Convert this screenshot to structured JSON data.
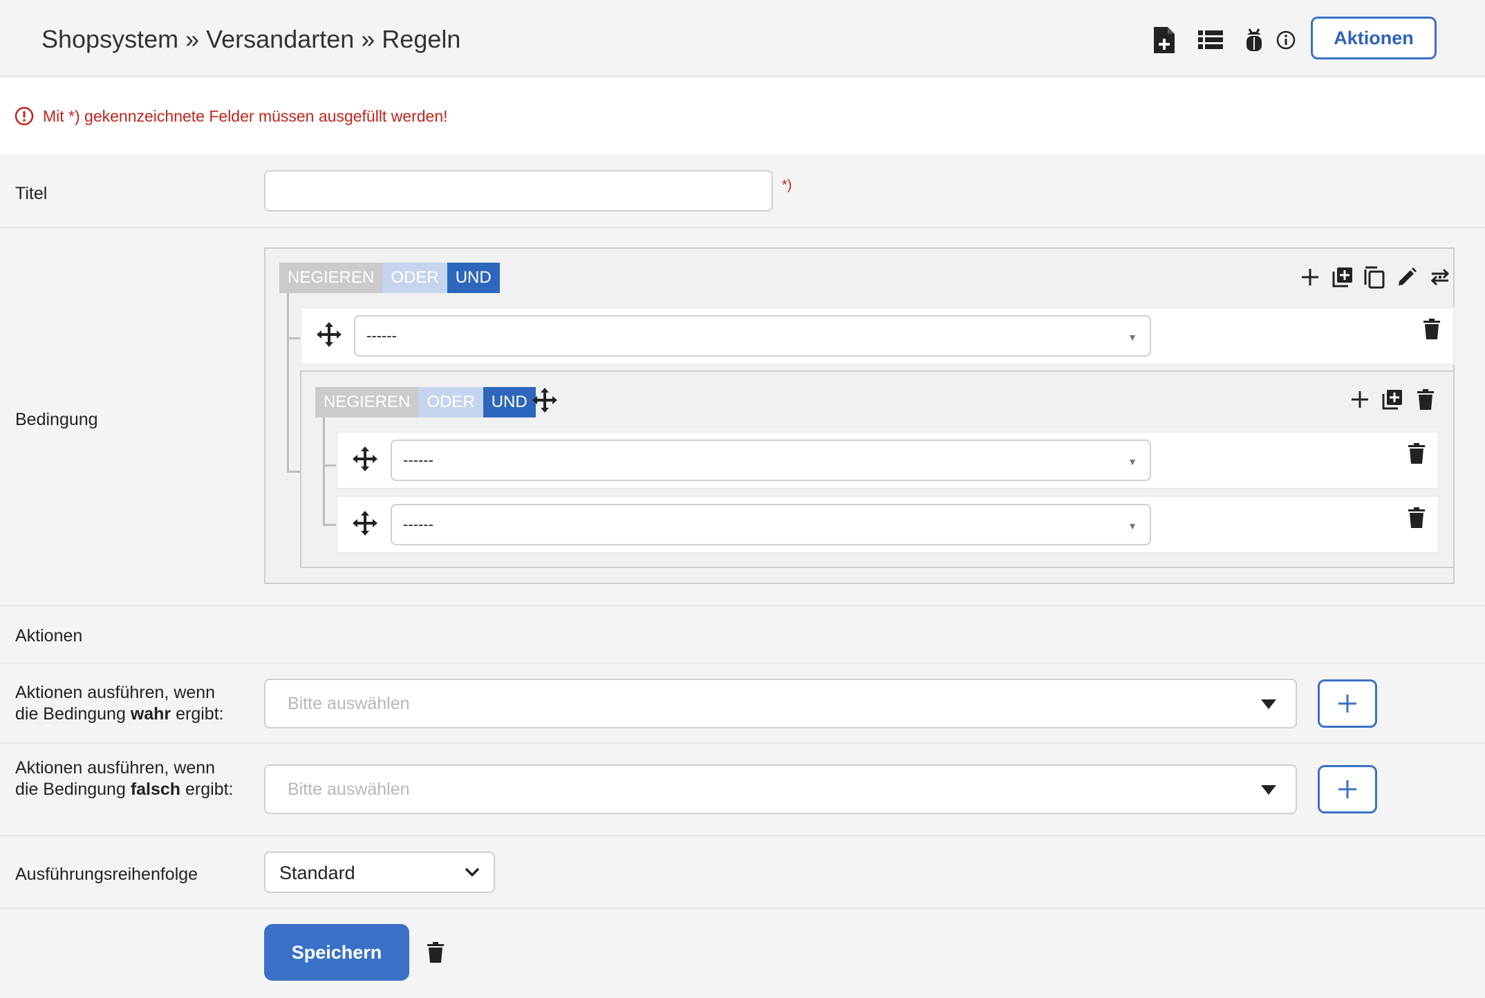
{
  "header": {
    "breadcrumb": "Shopsystem » Versandarten » Regeln",
    "actions_label": "Aktionen"
  },
  "notice": {
    "text": "Mit *) gekennzeichnete Felder müssen ausgefüllt werden!",
    "color": "#c0241a"
  },
  "fields": {
    "title_label": "Titel",
    "title_value": "",
    "required_mark": "*)",
    "condition_label": "Bedingung"
  },
  "query_builder": {
    "logic": {
      "negate": "NEGIEREN",
      "or": "ODER",
      "and": "UND",
      "active": "UND"
    },
    "rules": [
      {
        "value": "------"
      }
    ],
    "group": {
      "logic": {
        "negate": "NEGIEREN",
        "or": "ODER",
        "and": "UND",
        "active": "UND"
      },
      "rules": [
        {
          "value": "------"
        },
        {
          "value": "------"
        }
      ]
    }
  },
  "actions_section": {
    "heading": "Aktionen",
    "true_label_prefix": "Aktionen ausführen, wenn die Bedingung ",
    "true_label_bold": "wahr",
    "true_label_suffix": " ergibt:",
    "false_label_prefix": "Aktionen ausführen, wenn die Bedingung ",
    "false_label_bold": "falsch",
    "false_label_suffix": " ergibt:",
    "select_placeholder": "Bitte auswählen"
  },
  "order": {
    "label": "Ausführungsreihenfolge",
    "value": "Standard"
  },
  "footer": {
    "save_label": "Speichern"
  },
  "colors": {
    "accent": "#3a71c6",
    "and_active": "#2c67bd",
    "or_inactive": "#c6d4ee",
    "negate_inactive": "#cbcbcb"
  }
}
